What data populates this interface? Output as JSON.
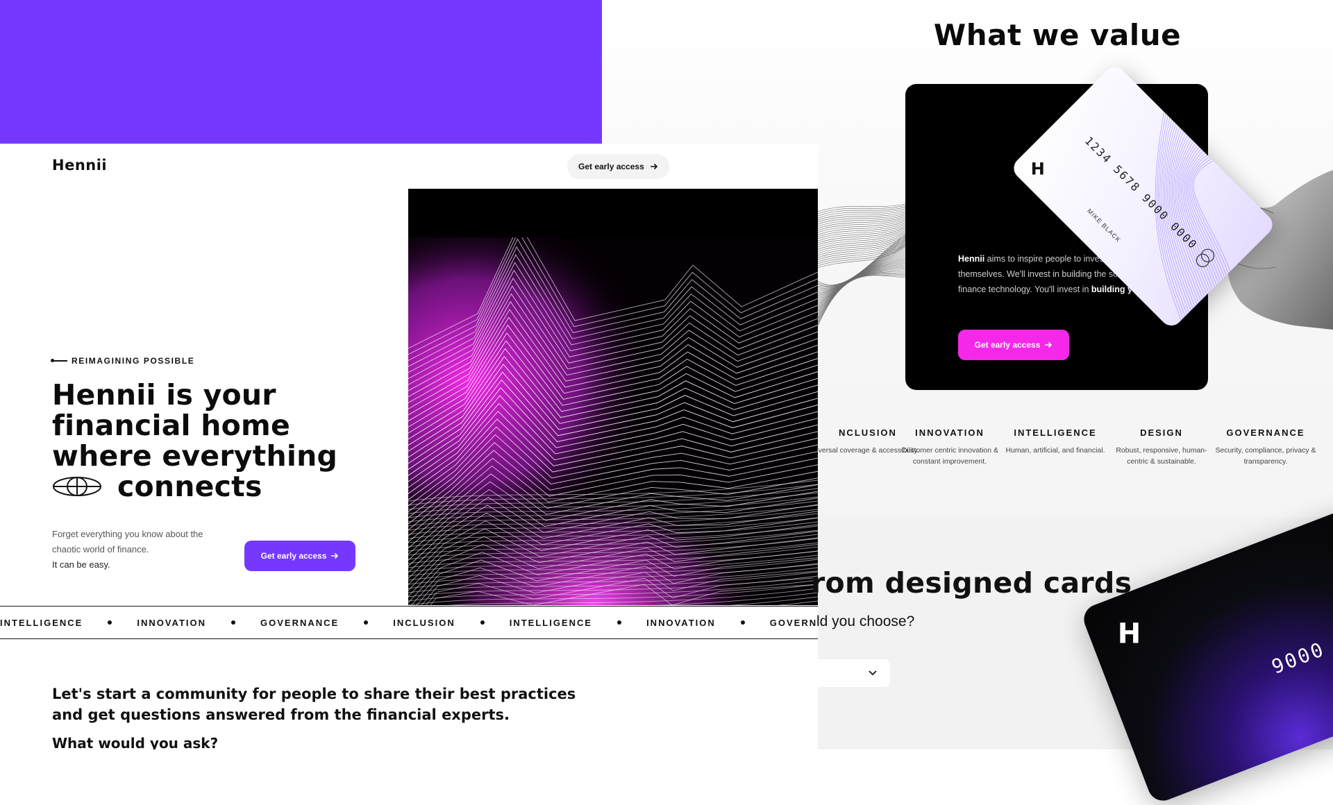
{
  "landing": {
    "logo": "Hennii",
    "nav_cta": "Get early access",
    "kicker": "REIMAGINING POSSIBLE",
    "hero_title": {
      "line1": "Hennii is your",
      "line2": "financial home",
      "line3": "where everything",
      "line4": "connects"
    },
    "hero_sub": {
      "line1": "Forget everything you know about the chaotic world of finance.",
      "line2": "It can be easy."
    },
    "primary_cta": "Get early access",
    "marquee": [
      "INTELLIGENCE",
      "INNOVATION",
      "GOVERNANCE",
      "INCLUSION",
      "INTELLIGENCE",
      "INNOVATION",
      "GOVERNANCE"
    ],
    "community_text": "Let's start a community for people to share their best practices and get questions answered from the financial experts.",
    "community_question": "What would you ask?"
  },
  "values": {
    "title": "What we value",
    "card": {
      "logo": "H",
      "number": "1234 5678 9000 0000",
      "name": "MIKE BLACK"
    },
    "body_brand": "Hennii",
    "body_text": " aims to inspire people to invest in themselves. We'll invest in building the social-finance technology. You'll invest in ",
    "body_bold_end": "building you.",
    "cta": "Get early access",
    "items": [
      {
        "title": "NCLUSION",
        "desc": "iversal coverage & accessibility."
      },
      {
        "title": "INNOVATION",
        "desc": "Customer centric innovation & constant improvement."
      },
      {
        "title": "INTELLIGENCE",
        "desc": "Human, artificial, and financial."
      },
      {
        "title": "DESIGN",
        "desc": "Robust, responsive, human-centric & sustainable."
      },
      {
        "title": "GOVERNANCE",
        "desc": "Security, compliance, privacy & transparency."
      }
    ]
  },
  "cards_section": {
    "title": "rom designed cards",
    "subtitle": "ld you choose?",
    "card_logo": "H",
    "card_number": "9000"
  },
  "colors": {
    "purple": "#7638ff",
    "pink": "#f527e9",
    "black": "#000000"
  },
  "icons": [
    "arrow-right-icon",
    "globe-icon",
    "chevron-down-icon",
    "mastercard-icon",
    "hand-image"
  ]
}
